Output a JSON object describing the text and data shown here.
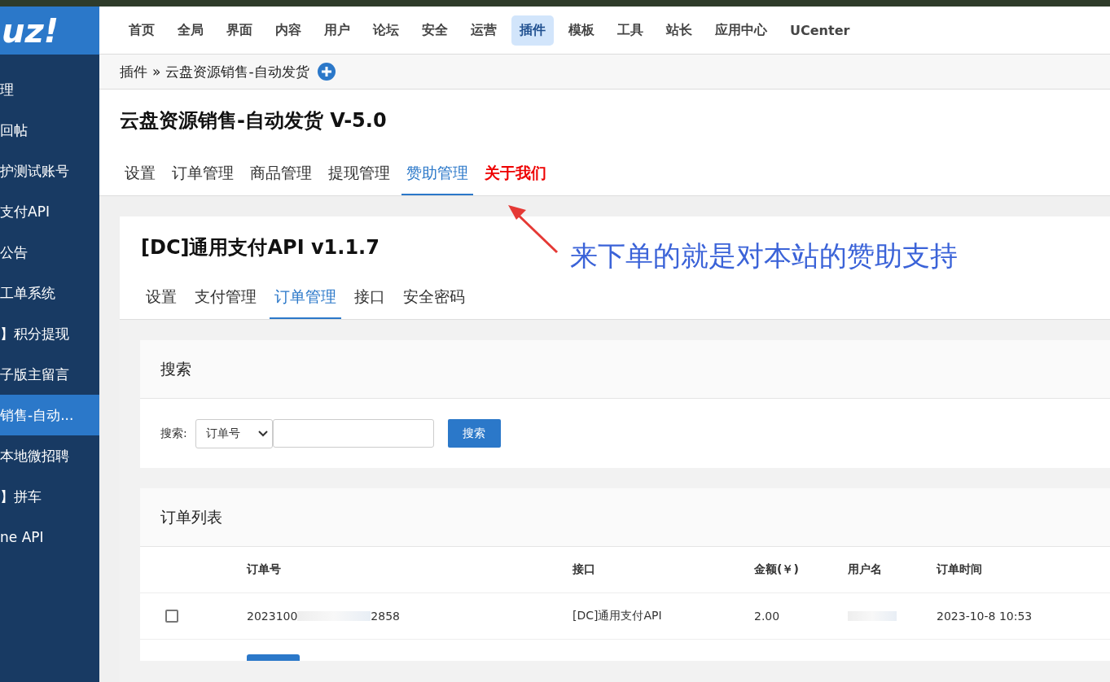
{
  "logo": {
    "text": "uz!"
  },
  "top_nav": [
    {
      "label": "首页",
      "selected": false
    },
    {
      "label": "全局",
      "selected": false
    },
    {
      "label": "界面",
      "selected": false
    },
    {
      "label": "内容",
      "selected": false
    },
    {
      "label": "用户",
      "selected": false
    },
    {
      "label": "论坛",
      "selected": false
    },
    {
      "label": "安全",
      "selected": false
    },
    {
      "label": "运营",
      "selected": false
    },
    {
      "label": "插件",
      "selected": true
    },
    {
      "label": "模板",
      "selected": false
    },
    {
      "label": "工具",
      "selected": false
    },
    {
      "label": "站长",
      "selected": false
    },
    {
      "label": "应用中心",
      "selected": false
    },
    {
      "label": "UCenter",
      "selected": false
    }
  ],
  "sidebar": {
    "items": [
      {
        "label": "理",
        "selected": false
      },
      {
        "label": "回帖",
        "selected": false
      },
      {
        "label": "护测试账号",
        "selected": false
      },
      {
        "label": "支付API",
        "selected": false
      },
      {
        "label": "公告",
        "selected": false
      },
      {
        "label": "工单系统",
        "selected": false
      },
      {
        "label": "】积分提现",
        "selected": false
      },
      {
        "label": "子版主留言",
        "selected": false
      },
      {
        "label": "销售-自动...",
        "selected": true
      },
      {
        "label": "本地微招聘",
        "selected": false
      },
      {
        "label": "】拼车",
        "selected": false
      },
      {
        "label": "ne API",
        "selected": false
      }
    ]
  },
  "breadcrumb": {
    "parent": "插件",
    "separator": "»",
    "current": "云盘资源销售-自动发货"
  },
  "plugin": {
    "title": "云盘资源销售-自动发货 V-5.0",
    "tabs": [
      {
        "label": "设置",
        "selected": false,
        "kind": "normal"
      },
      {
        "label": "订单管理",
        "selected": false,
        "kind": "normal"
      },
      {
        "label": "商品管理",
        "selected": false,
        "kind": "normal"
      },
      {
        "label": "提现管理",
        "selected": false,
        "kind": "normal"
      },
      {
        "label": "赞助管理",
        "selected": true,
        "kind": "normal"
      },
      {
        "label": "关于我们",
        "selected": false,
        "kind": "highlight"
      }
    ]
  },
  "annotation": {
    "text": "来下单的就是对本站的赞助支持"
  },
  "sub_plugin": {
    "title": "[DC]通用支付API v1.1.7",
    "tabs": [
      {
        "label": "设置",
        "selected": false
      },
      {
        "label": "支付管理",
        "selected": false
      },
      {
        "label": "订单管理",
        "selected": true
      },
      {
        "label": "接口",
        "selected": false
      },
      {
        "label": "安全密码",
        "selected": false
      }
    ]
  },
  "search_card": {
    "title": "搜索",
    "label": "搜索:",
    "select_value": "订单号",
    "button": "搜索"
  },
  "order_card": {
    "title": "订单列表",
    "columns": [
      "订单号",
      "接口",
      "金额(￥)",
      "用户名",
      "订单时间"
    ],
    "rows": [
      {
        "checked": false,
        "order_no_start": "2023100",
        "order_no_end": "2858",
        "gateway": "[DC]通用支付API",
        "amount": "2.00",
        "time": "2023-10-8 10:53"
      }
    ]
  }
}
